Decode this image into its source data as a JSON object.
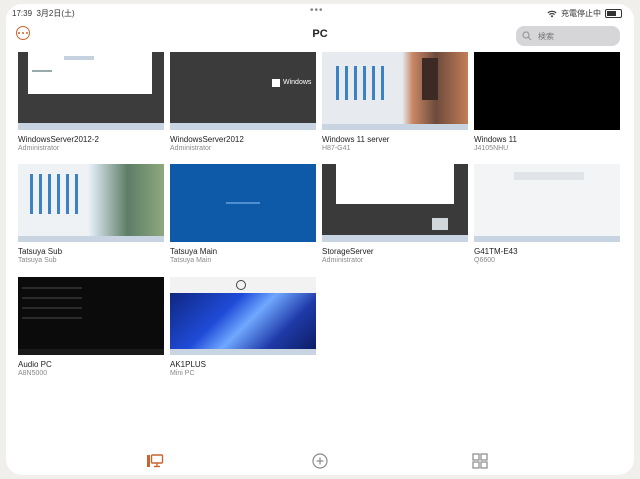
{
  "status": {
    "time": "17:39",
    "date": "3月2日(土)",
    "dots": "•••",
    "charge_text": "充電停止中"
  },
  "nav": {
    "title": "PC",
    "more_icon": "ellipsis-circle-icon",
    "search_placeholder": "検索"
  },
  "pcs": [
    {
      "name": "WindowsServer2012-2",
      "user": "Administrator"
    },
    {
      "name": "WindowsServer2012",
      "user": "Administrator",
      "thumb_text": "Windows"
    },
    {
      "name": "Windows 11 server",
      "user": "H87-G41"
    },
    {
      "name": "Windows 11",
      "user": "J4105NHU"
    },
    {
      "name": "Tatsuya Sub",
      "user": "Tatsuya Sub"
    },
    {
      "name": "Tatsuya Main",
      "user": "Tatsuya Main"
    },
    {
      "name": "StorageServer",
      "user": "Administrator"
    },
    {
      "name": "G41TM-E43",
      "user": "Q6600"
    },
    {
      "name": "Audio PC",
      "user": "A8N5000"
    },
    {
      "name": "AK1PLUS",
      "user": "Mini PC"
    }
  ],
  "tabs": [
    {
      "icon": "desktop-icon",
      "active": true
    },
    {
      "icon": "plus-circle-icon",
      "active": false
    },
    {
      "icon": "apps-grid-icon",
      "active": false
    }
  ],
  "colors": {
    "accent": "#c8642f",
    "win_blue": "#0f5aa8"
  }
}
